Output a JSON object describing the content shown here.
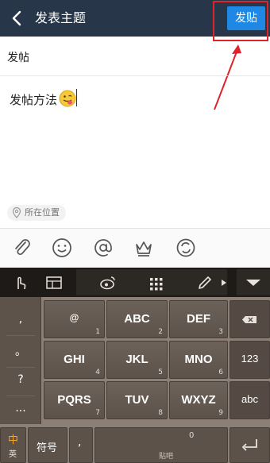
{
  "header": {
    "title": "发表主题",
    "send_label": "发贴"
  },
  "subject": {
    "value": "发帖"
  },
  "body": {
    "value": "发帖方法"
  },
  "location": {
    "label": "所在位置"
  },
  "toolbar": {
    "icons": [
      "paperclip-icon",
      "smiley-icon",
      "at-sign-icon",
      "crown-icon",
      "refresh-icon"
    ]
  },
  "keyboard": {
    "side_symbols": [
      ",",
      "。",
      "?",
      "..."
    ],
    "rows": [
      [
        {
          "main": "@",
          "num": "1"
        },
        {
          "main": "ABC",
          "num": "2"
        },
        {
          "main": "DEF",
          "num": "3"
        }
      ],
      [
        {
          "main": "GHI",
          "num": "4"
        },
        {
          "main": "JKL",
          "num": "5"
        },
        {
          "main": "MNO",
          "num": "6"
        }
      ],
      [
        {
          "main": "PQRS",
          "num": "7"
        },
        {
          "main": "TUV",
          "num": "8"
        },
        {
          "main": "WXYZ",
          "num": "9"
        }
      ]
    ],
    "num_key": "123",
    "abc_key": "abc",
    "lang_top": "中",
    "lang_bottom": "英",
    "symbols_key": "符号",
    "comma_key": ",",
    "zero_key": "0",
    "space_label": "贴吧"
  },
  "colors": {
    "header_bg": "#283649",
    "send_button": "#1f88e5",
    "highlight_box": "#e0222a"
  }
}
